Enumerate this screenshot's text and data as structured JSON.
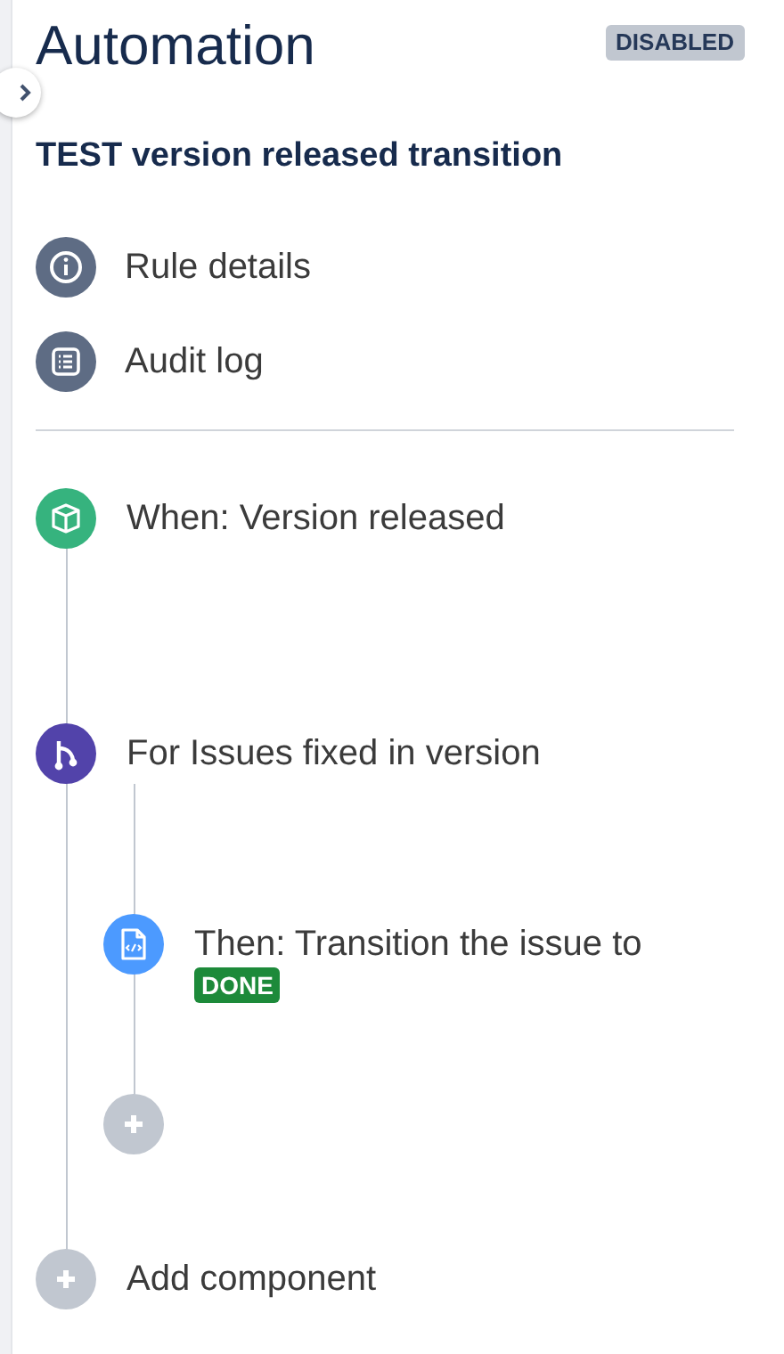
{
  "header": {
    "title": "Automation",
    "status": "DISABLED"
  },
  "rule_name": "TEST version released transition",
  "nav": [
    {
      "label": "Rule details",
      "kind": "info"
    },
    {
      "label": "Audit log",
      "kind": "list"
    }
  ],
  "components": [
    {
      "kind": "trigger",
      "label": "When: Version released"
    },
    {
      "kind": "branch",
      "label": "For Issues fixed in version",
      "children": [
        {
          "kind": "action",
          "label": "Then: Transition the issue to",
          "status": "DONE"
        },
        {
          "kind": "add"
        }
      ]
    },
    {
      "kind": "add",
      "label": "Add component"
    }
  ]
}
